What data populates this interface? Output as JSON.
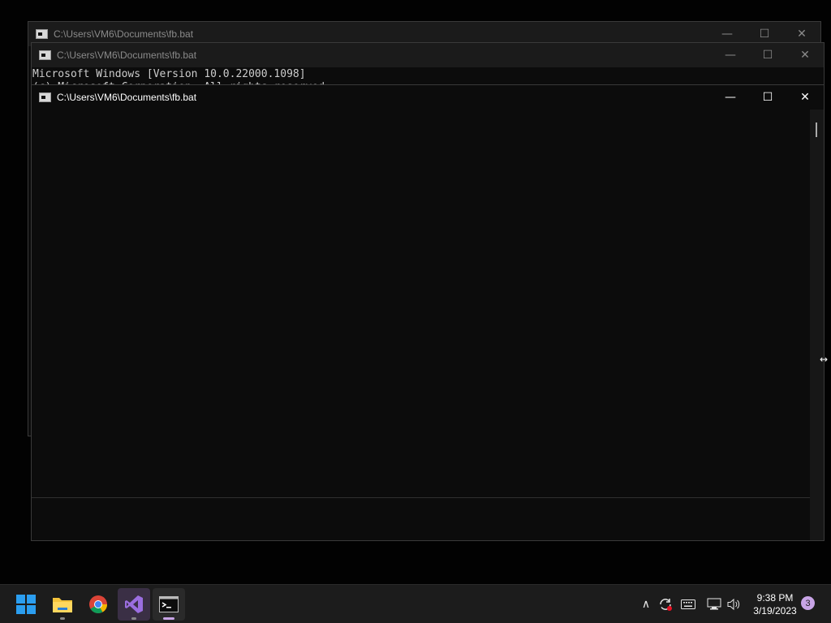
{
  "windows": [
    {
      "title": "C:\\Users\\VM6\\Documents\\fb.bat",
      "controls": {
        "minimize": "—",
        "maximize": "☐",
        "close": "✕"
      }
    },
    {
      "title": "C:\\Users\\VM6\\Documents\\fb.bat",
      "controls": {
        "minimize": "—",
        "maximize": "☐",
        "close": "✕"
      },
      "console_lines": [
        "Microsoft Windows [Version 10.0.22000.1098]",
        "(c) Microsoft Corporation. All rights reserved."
      ]
    },
    {
      "title": "C:\\Users\\VM6\\Documents\\fb.bat",
      "controls": {
        "minimize": "—",
        "maximize": "☐",
        "close": "✕"
      }
    }
  ],
  "taskbar": {
    "apps": [
      {
        "name": "start-button",
        "icon": "windows-logo-icon"
      },
      {
        "name": "file-explorer",
        "icon": "folder-icon"
      },
      {
        "name": "chrome",
        "icon": "chrome-icon"
      },
      {
        "name": "visual-studio",
        "icon": "visual-studio-icon"
      },
      {
        "name": "command-prompt",
        "icon": "terminal-icon"
      }
    ],
    "tray": {
      "overflow_glyph": "∧",
      "time": "9:38 PM",
      "date": "3/19/2023",
      "notification_count": "3"
    }
  },
  "colors": {
    "accent": "#0078d4",
    "vs_purple": "#7b5cd6",
    "taskbar_bg": "#1c1c1c",
    "console_bg": "#0c0c0c"
  }
}
